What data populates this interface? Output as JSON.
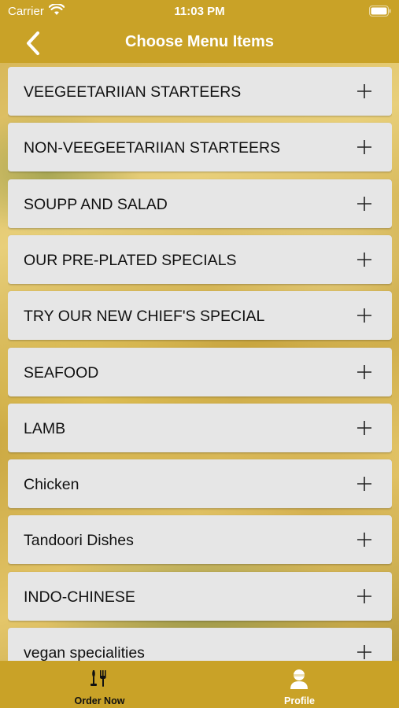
{
  "status_bar": {
    "carrier": "Carrier",
    "time": "11:03 PM"
  },
  "nav": {
    "title": "Choose Menu Items",
    "back_icon": "chevron-left-icon"
  },
  "menu": {
    "items": [
      {
        "label": "VEEGEETARIIAN STARTEERS"
      },
      {
        "label": "NON-VEEGEETARIIAN STARTEERS"
      },
      {
        "label": "SOUPP AND SALAD"
      },
      {
        "label": "OUR PRE-PLATED SPECIALS"
      },
      {
        "label": "TRY OUR NEW CHIEF'S SPECIAL"
      },
      {
        "label": "SEAFOOD"
      },
      {
        "label": "LAMB"
      },
      {
        "label": "Chicken"
      },
      {
        "label": "Tandoori Dishes"
      },
      {
        "label": "INDO-CHINESE"
      },
      {
        "label": "vegan specialities"
      }
    ],
    "expand_icon": "plus-icon"
  },
  "tabs": [
    {
      "label": "Order Now",
      "icon": "fork-knife-icon",
      "active": false
    },
    {
      "label": "Profile",
      "icon": "user-icon",
      "active": true
    }
  ],
  "colors": {
    "brand": "#c9a227",
    "card": "#e6e6e6",
    "text": "#111111"
  }
}
